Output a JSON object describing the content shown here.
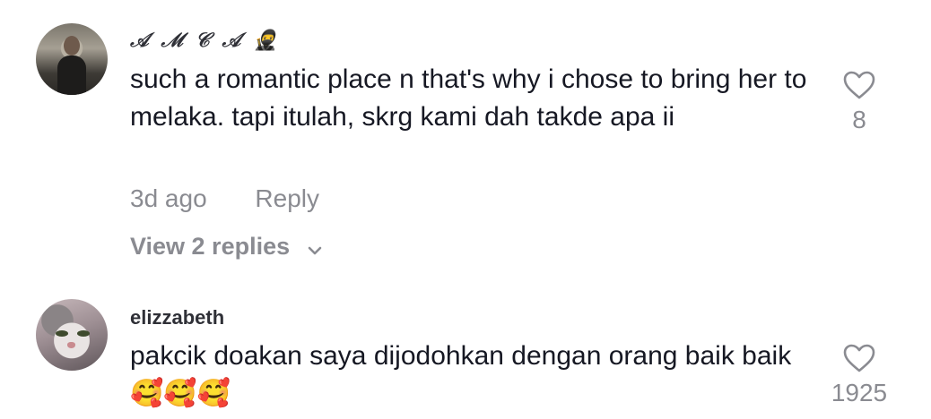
{
  "comments": [
    {
      "username": "𝒜 ℳ 𝒞 𝒜 🥷",
      "text": "such a romantic place n that's why i chose to bring her to melaka. tapi itulah, skrg kami dah takde apa ii",
      "time": "3d ago",
      "reply_label": "Reply",
      "view_replies_label": "View 2 replies",
      "like_count": "8",
      "avatar_icon": "user-photo-avatar"
    },
    {
      "username": "elizzabeth",
      "text": "pakcik doakan saya dijodohkan dengan orang baik baik 🥰🥰🥰",
      "like_count": "1925",
      "avatar_icon": "cat-photo-avatar"
    }
  ],
  "icons": {
    "like": "heart-outline-icon",
    "expand": "chevron-down-icon"
  },
  "colors": {
    "text_primary": "#161823",
    "text_secondary": "#8a8b91"
  }
}
